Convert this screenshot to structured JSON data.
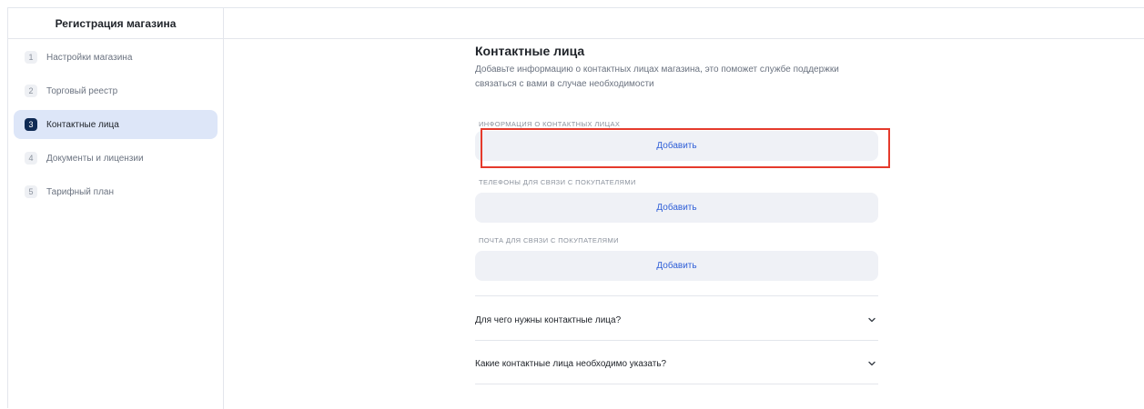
{
  "sidebar": {
    "title": "Регистрация магазина",
    "steps": [
      {
        "num": "1",
        "label": "Настройки магазина"
      },
      {
        "num": "2",
        "label": "Торговый реестр"
      },
      {
        "num": "3",
        "label": "Контактные лица"
      },
      {
        "num": "4",
        "label": "Документы и лицензии"
      },
      {
        "num": "5",
        "label": "Тарифный план"
      }
    ],
    "active_step": 3
  },
  "main": {
    "title": "Контактные лица",
    "description": "Добавьте информацию о контактных лицах магазина, это поможет службе поддержки связаться с вами в случае необходимости",
    "sections": [
      {
        "label": "Информация о контактных лицах",
        "button": "Добавить"
      },
      {
        "label": "Телефоны для связи с покупателями",
        "button": "Добавить"
      },
      {
        "label": "Почта для связи с покупателями",
        "button": "Добавить"
      }
    ],
    "faq": [
      {
        "question": "Для чего нужны контактные лица?"
      },
      {
        "question": "Какие контактные лица необходимо указать?"
      }
    ]
  },
  "colors": {
    "accent": "#2f5fd8",
    "active_step_bg": "#dde6f8",
    "active_badge": "#0f2a54",
    "highlight": "#e53a2c"
  },
  "icons": {
    "faq_toggle": "chevron-down-icon"
  }
}
